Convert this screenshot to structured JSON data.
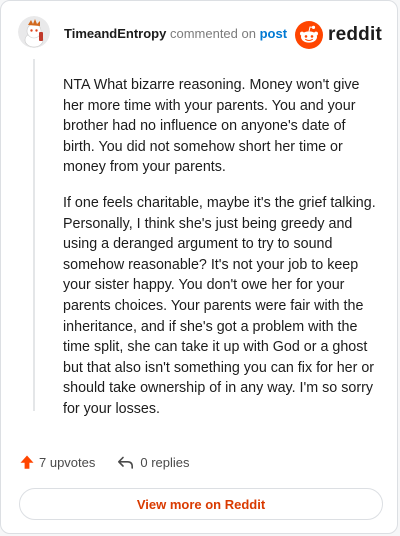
{
  "comment": {
    "author": "TimeandEntropy",
    "action_text": "commented on",
    "post_link_label": "post",
    "paragraphs": [
      "NTA What bizarre reasoning. Money won't give her more time with your parents. You and your brother had no influence on anyone's date of birth. You did not somehow short her time or money from your parents.",
      "If one feels charitable, maybe it's the grief talking. Personally, I think she's just being greedy and using a deranged argument to try to sound somehow reasonable? It's not your job to keep your sister happy. You don't owe her for your parents choices. Your parents were fair with the inheritance, and if she's got a problem with the time split, she can take it up with God or a ghost but that also isn't something you can fix for her or should take ownership of in any way. I'm so sorry for your losses."
    ]
  },
  "brand": {
    "name": "reddit",
    "icon": "reddit-logo-icon",
    "color": "#ff4500"
  },
  "footer": {
    "upvotes_label": "7 upvotes",
    "replies_label": "0 replies",
    "view_more_label": "View more on Reddit"
  },
  "colors": {
    "accent": "#ff4500",
    "link": "#0079d3",
    "view_more": "#d93a00"
  }
}
